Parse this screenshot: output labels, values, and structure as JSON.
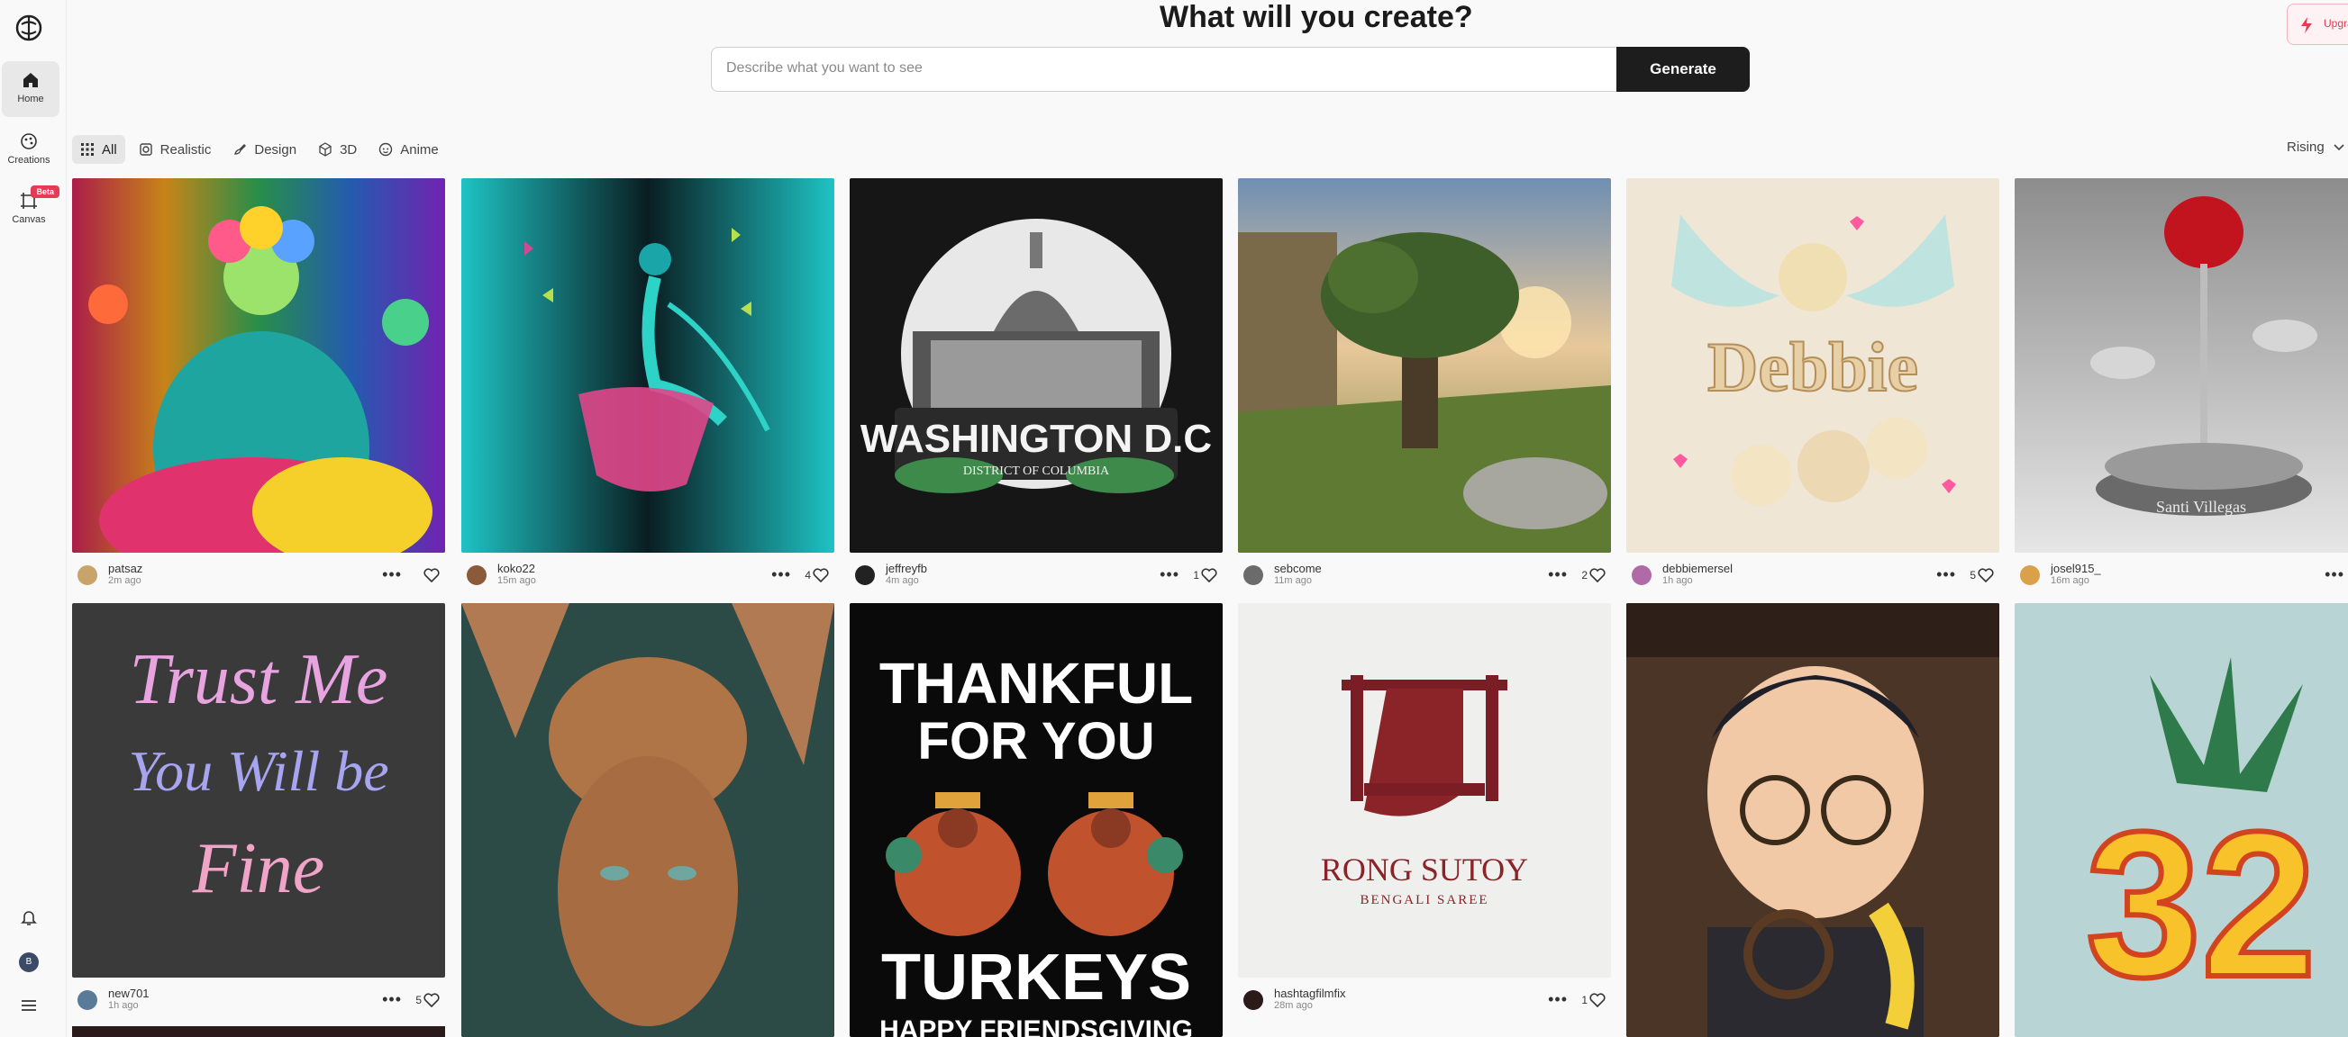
{
  "header": {
    "title": "What will you create?",
    "search_placeholder": "Describe what you want to see",
    "generate_label": "Generate",
    "upgrade_label": "Upgrade"
  },
  "sidebar": {
    "items": [
      {
        "label": "Home",
        "icon": "home-icon"
      },
      {
        "label": "Creations",
        "icon": "creations-icon"
      },
      {
        "label": "Canvas",
        "icon": "canvas-icon",
        "badge": "Beta"
      }
    ],
    "avatar_initial": "B"
  },
  "filters": {
    "chips": [
      "All",
      "Realistic",
      "Design",
      "3D",
      "Anime"
    ],
    "sort_label": "Rising"
  },
  "cards_row1": [
    {
      "user": "patsaz",
      "time": "2m ago",
      "likes": "",
      "avatar_color": "#c9a46a"
    },
    {
      "user": "koko22",
      "time": "15m ago",
      "likes": "4",
      "avatar_color": "#8a5a3a"
    },
    {
      "user": "jeffreyfb",
      "time": "4m ago",
      "likes": "1",
      "avatar_color": "#222222"
    },
    {
      "user": "sebcome",
      "time": "11m ago",
      "likes": "2",
      "avatar_color": "#6b6b6b"
    },
    {
      "user": "debbiemersel",
      "time": "1h ago",
      "likes": "5",
      "avatar_color": "#b06aa8"
    },
    {
      "user": "josel915_",
      "time": "16m ago",
      "likes": "",
      "avatar_color": "#d9a24a"
    }
  ],
  "cards_row2": [
    {
      "user": "new701",
      "time": "1h ago",
      "likes": "5",
      "avatar_color": "#5a7a9a"
    },
    {
      "user": "hashtagfilmfix",
      "time": "28m ago",
      "likes": "1",
      "avatar_color": "#2a1a1a"
    }
  ],
  "images": {
    "washington_title": "WASHINGTON D.C",
    "washington_sub": "DISTRICT OF COLUMBIA",
    "debbie_text": "Debbie",
    "rose_base": "Santi Villegas",
    "trust_line1": "Trust Me",
    "trust_line2": "You Will be",
    "trust_line3": "Fine",
    "thankful_line1": "THANKFUL",
    "thankful_line2": "FOR YOU",
    "thankful_line3": "TURKEYS",
    "thankful_line4": "HAPPY FRIENDSGIVING",
    "rong_title": "RONG SUTOY",
    "rong_sub": "BENGALI SAREE",
    "number_text": "32"
  }
}
